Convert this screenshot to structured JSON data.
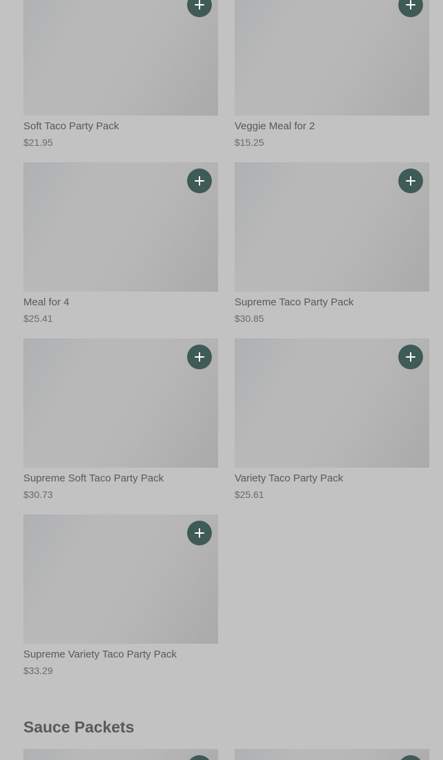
{
  "products": [
    {
      "name": "Soft Taco Party Pack",
      "price": "$21.95"
    },
    {
      "name": "Veggie Meal for 2",
      "price": "$15.25"
    },
    {
      "name": "Meal for 4",
      "price": "$25.41"
    },
    {
      "name": "Supreme Taco Party Pack",
      "price": "$30.85"
    },
    {
      "name": "Supreme Soft Taco Party Pack",
      "price": "$30.73"
    },
    {
      "name": "Variety Taco Party Pack",
      "price": "$25.61"
    },
    {
      "name": "Supreme Variety Taco Party Pack",
      "price": "$33.29"
    }
  ],
  "sections": {
    "sauce_title": "Sauce Packets"
  },
  "icons": {
    "add": "plus-icon"
  },
  "colors": {
    "add_button": "#3f5b55",
    "background": "#c2c2c2"
  }
}
